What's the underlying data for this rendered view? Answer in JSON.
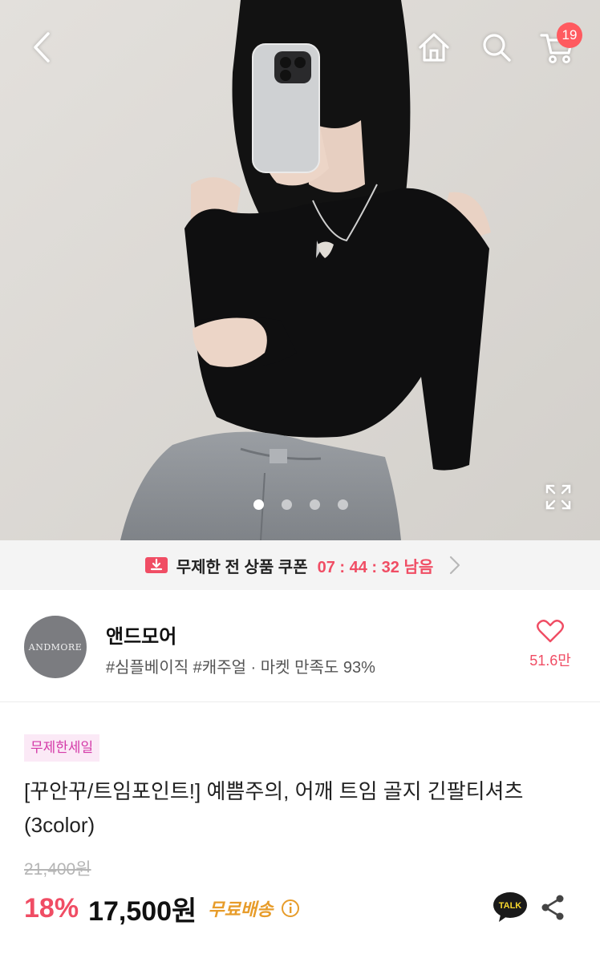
{
  "header": {
    "cart_count": "19"
  },
  "gallery": {
    "page_count": 4,
    "active_index": 0
  },
  "coupon": {
    "label": "무제한 전 상품 쿠폰",
    "timer": "07 : 44 : 32 남음",
    "accent_color": "#f04d64"
  },
  "seller": {
    "logo_text": "ANDMORE",
    "name": "앤드모어",
    "tags": "#심플베이직 #캐주얼 · 마켓 만족도 93%",
    "like_count": "51.6만"
  },
  "product": {
    "badge": "무제한세일",
    "title": "[꾸안꾸/트임포인트!] 예쁨주의, 어깨 트임 골지 긴팔티셔츠 (3color)",
    "original_price": "21,400원",
    "discount": "18%",
    "price": "17,500원",
    "shipping": "무료배송"
  },
  "actions": {
    "talk_label": "TALK"
  },
  "icons": {
    "back": "chevron-left-icon",
    "home": "home-icon",
    "search": "search-icon",
    "cart": "cart-icon",
    "expand": "expand-icon",
    "coupon": "coupon-download-icon",
    "heart": "heart-icon",
    "info": "info-icon",
    "share": "share-icon"
  }
}
